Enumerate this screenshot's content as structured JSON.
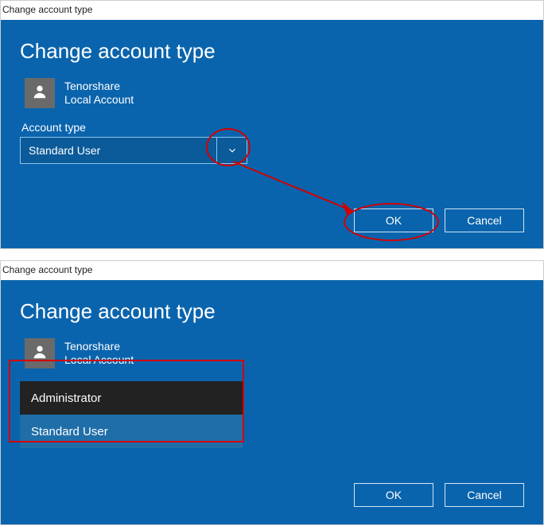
{
  "top": {
    "windowTitle": "Change account type",
    "heading": "Change account type",
    "user": {
      "name": "Tenorshare",
      "kind": "Local Account"
    },
    "sectionLabel": "Account type",
    "dropdownValue": "Standard User",
    "buttons": {
      "ok": "OK",
      "cancel": "Cancel"
    }
  },
  "bottom": {
    "windowTitle": "Change account type",
    "heading": "Change account type",
    "user": {
      "name": "Tenorshare",
      "kind": "Local Account"
    },
    "options": {
      "administrator": "Administrator",
      "standard": "Standard User"
    },
    "buttons": {
      "ok": "OK",
      "cancel": "Cancel"
    }
  }
}
